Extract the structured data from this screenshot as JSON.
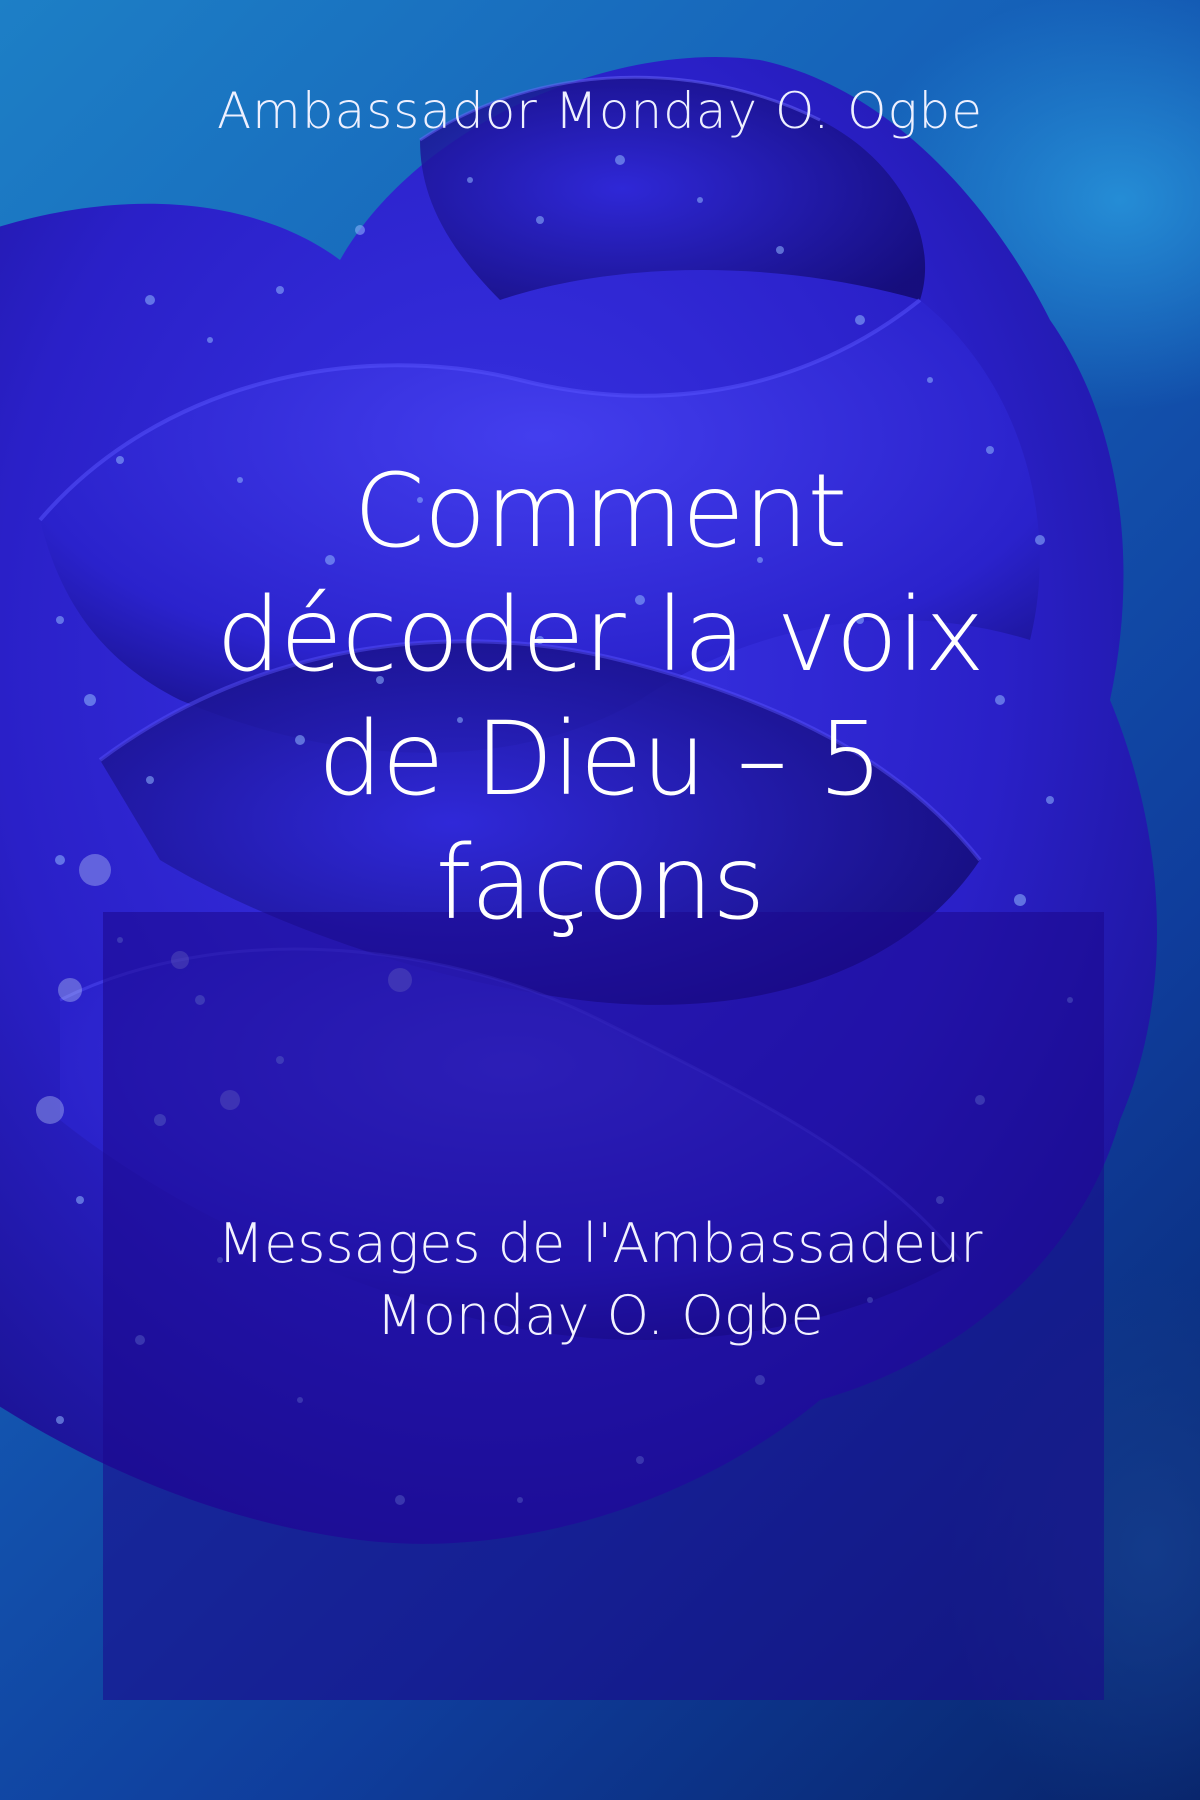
{
  "cover": {
    "author": "Ambassador Monday O. Ogbe",
    "title_lines": [
      "Comment",
      "décoder la voix",
      "de Dieu – 5",
      "façons"
    ],
    "subtitle_lines": [
      "Messages de l'Ambassadeur",
      "Monday O. Ogbe"
    ],
    "colors": {
      "background": "#1560b8",
      "rose": "#2a1fd0",
      "panel": "#1c088c",
      "text": "#ffffff"
    },
    "image": "blue-rose-with-water-droplets"
  }
}
